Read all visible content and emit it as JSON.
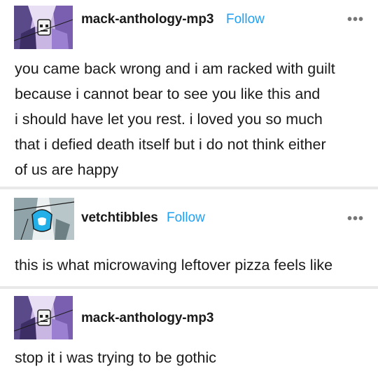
{
  "posts": [
    {
      "username": "mack-anthology-mp3",
      "follow_label": "Follow",
      "more_label": "•••",
      "avatar_icon": "robot-avatar-icon",
      "lines": [
        "you came back wrong and i am racked with guilt",
        "because i cannot bear to see you like this and",
        "i should have let you rest. i loved you so much",
        "that i defied death itself but i do not think either",
        "of us are happy"
      ]
    },
    {
      "username": "vetchtibbles",
      "follow_label": "Follow",
      "more_label": "•••",
      "avatar_icon": "robot-avatar-icon",
      "lines": [
        "this is what microwaving leftover pizza feels like"
      ]
    },
    {
      "username": "mack-anthology-mp3",
      "avatar_icon": "robot-avatar-icon",
      "lines": [
        "stop it i was trying to be gothic"
      ]
    }
  ],
  "colors": {
    "follow": "#1fa0f3",
    "divider": "#e9e9e9"
  }
}
